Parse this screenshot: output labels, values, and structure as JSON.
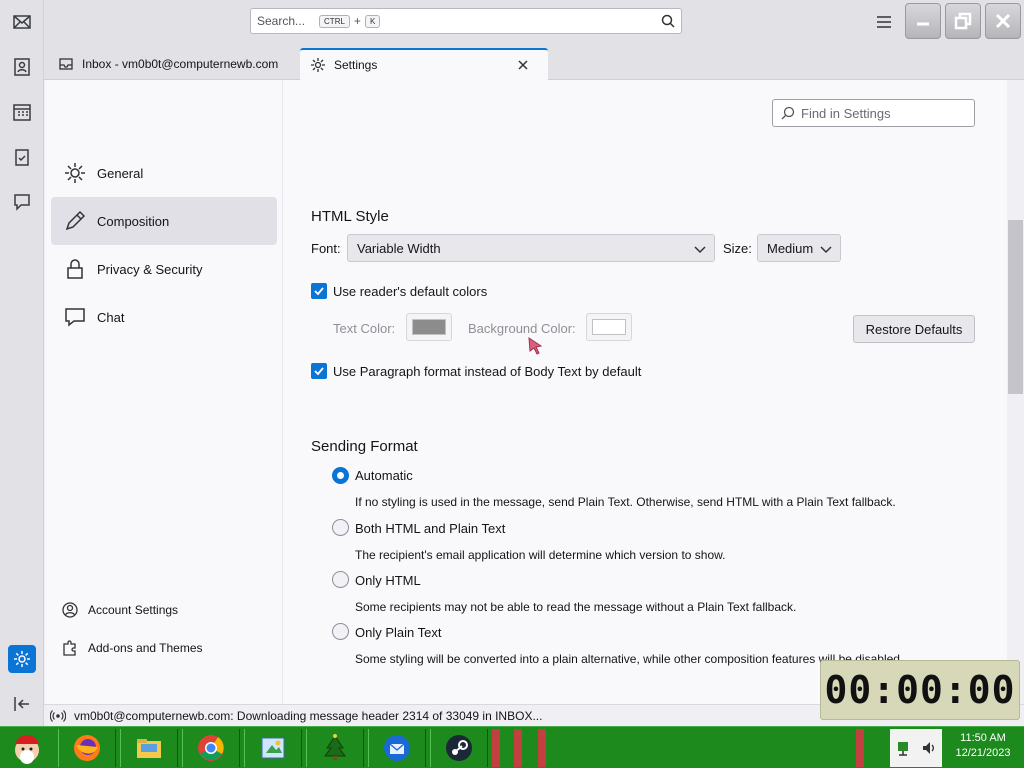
{
  "titlebar": {
    "search_placeholder": "Search...",
    "search_key1": "CTRL",
    "search_plus": "+",
    "search_key2": "K"
  },
  "tabs": [
    {
      "label": "Inbox - vm0b0t@computernewb.com"
    },
    {
      "label": "Settings"
    }
  ],
  "nav": {
    "items": [
      {
        "label": "General"
      },
      {
        "label": "Composition"
      },
      {
        "label": "Privacy & Security"
      },
      {
        "label": "Chat"
      }
    ],
    "footer": [
      {
        "label": "Account Settings"
      },
      {
        "label": "Add-ons and Themes"
      }
    ]
  },
  "find_placeholder": "Find in Settings",
  "html_style": {
    "title": "HTML Style",
    "font_label": "Font:",
    "font_value": "Variable Width",
    "size_label": "Size:",
    "size_value": "Medium",
    "use_reader_colors": "Use reader's default colors",
    "text_color_label": "Text Color:",
    "bg_color_label": "Background Color:",
    "restore_defaults": "Restore Defaults",
    "use_paragraph": "Use Paragraph format instead of Body Text by default",
    "text_color": "#8c8c8c",
    "bg_color": "#ffffff"
  },
  "sending_format": {
    "title": "Sending Format",
    "options": [
      {
        "label": "Automatic",
        "desc": "If no styling is used in the message, send Plain Text. Otherwise, send HTML with a Plain Text fallback.",
        "checked": true
      },
      {
        "label": "Both HTML and Plain Text",
        "desc": "The recipient's email application will determine which version to show.",
        "checked": false
      },
      {
        "label": "Only HTML",
        "desc": "Some recipients may not be able to read the message without a Plain Text fallback.",
        "checked": false
      },
      {
        "label": "Only Plain Text",
        "desc": "Some styling will be converted into a plain alternative, while other composition features will be disabled.",
        "checked": false
      }
    ]
  },
  "status_text": "vm0b0t@computernewb.com: Downloading message header 2314 of 33049 in INBOX...",
  "timer": "00:00:00",
  "clock": {
    "time": "11:50 AM",
    "date": "12/21/2023"
  },
  "colors": {
    "accent": "#0b75d6",
    "taskbar": "#1c8a1c"
  }
}
